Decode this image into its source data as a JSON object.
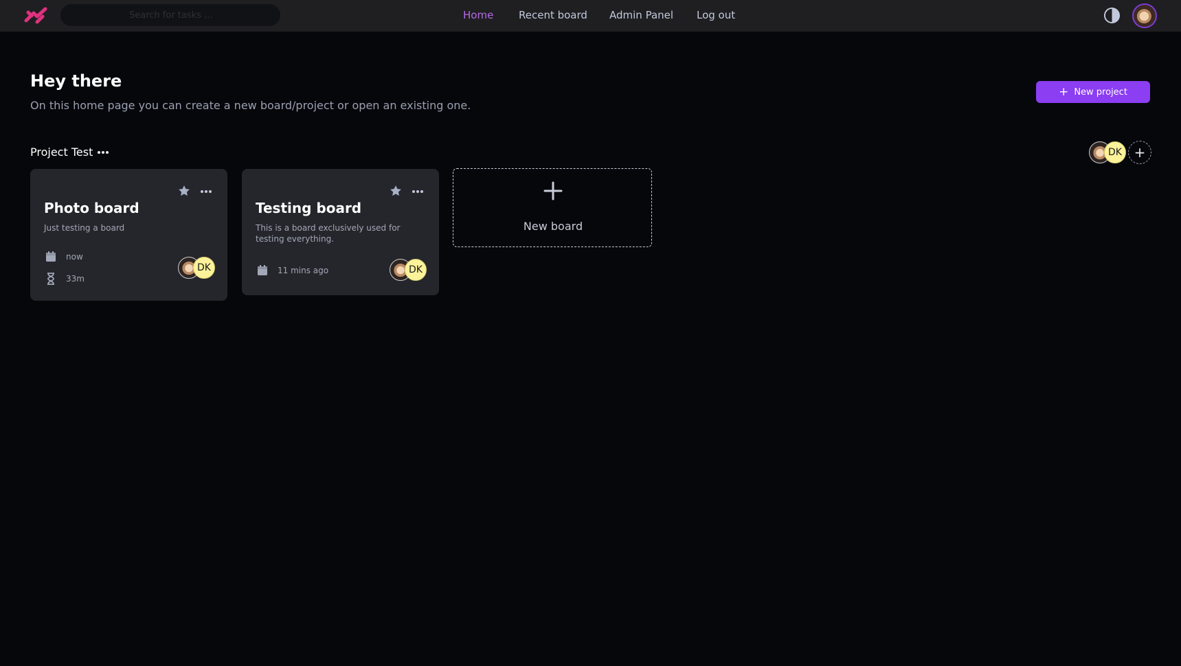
{
  "header": {
    "logo_icon": "brand-logo-icon",
    "search": {
      "placeholder": "Search for tasks ...",
      "value": ""
    },
    "nav": [
      {
        "label": "Home",
        "active": true
      },
      {
        "label": "Recent board",
        "active": false
      },
      {
        "label": "Admin Panel",
        "active": false
      },
      {
        "label": "Log out",
        "active": false
      }
    ],
    "theme_toggle_icon": "contrast-icon",
    "avatar_icon": "user-avatar"
  },
  "hero": {
    "title": "Hey there",
    "subtitle": "On this home page you can create a new board/project or open an existing one.",
    "new_project_label": "New project"
  },
  "project": {
    "name": "Project Test",
    "members": [
      {
        "type": "photo"
      },
      {
        "initials": "DK"
      }
    ],
    "boards": [
      {
        "title": "Photo board",
        "description": "Just testing a board",
        "created": "now",
        "duration": "33m",
        "members_initials": "DK"
      },
      {
        "title": "Testing board",
        "description": "This is a board exclusively used for testing everything.",
        "created": "11 mins ago",
        "members_initials": "DK"
      }
    ],
    "new_board_label": "New board"
  },
  "colors": {
    "accent": "#8b3ef2",
    "nav_active": "#b76be6",
    "background": "#06070b",
    "topbar": "#1f1f22",
    "card": "#25262b",
    "initials_avatar": "#fcf29a",
    "logo": "#e0317f"
  }
}
